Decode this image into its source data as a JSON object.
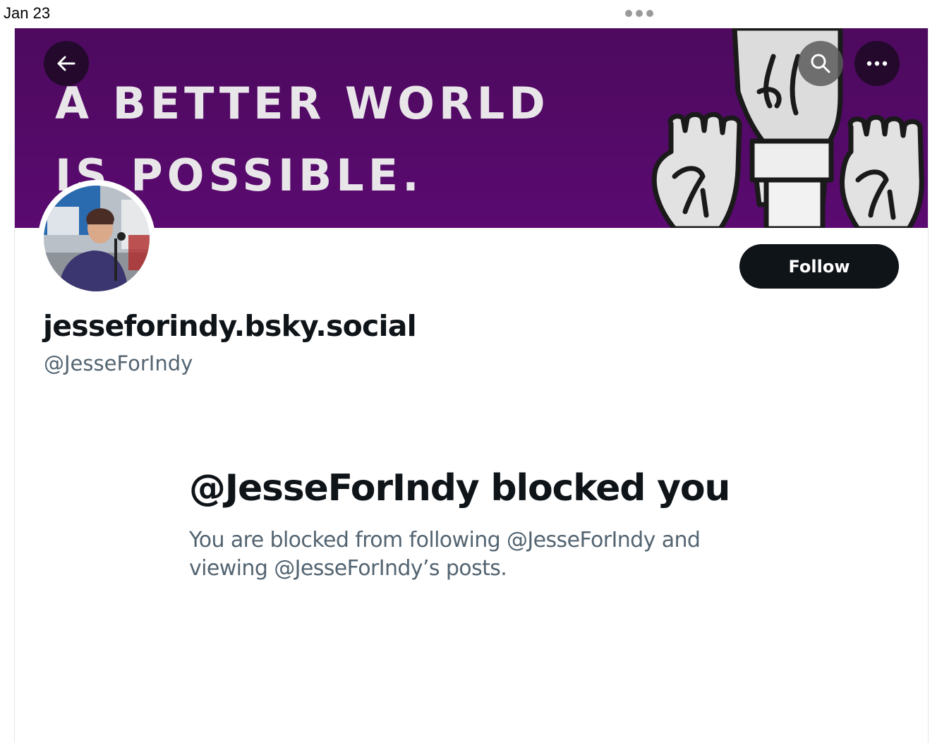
{
  "status_bar": {
    "date": "Jan 23"
  },
  "banner": {
    "line1": "A BETTER WORLD",
    "line2": "IS POSSIBLE.",
    "background_color": "#5a0a70"
  },
  "header_buttons": {
    "back_icon": "arrow-left-icon",
    "search_icon": "search-icon",
    "more_icon": "more-horizontal-icon"
  },
  "profile": {
    "display_name": "jesseforindy.bsky.social",
    "handle": "@JesseForIndy",
    "follow_label": "Follow"
  },
  "blocked": {
    "title": "@JesseForIndy blocked you",
    "description": "You are blocked from following @JesseForIndy and viewing @JesseForIndy’s posts."
  },
  "colors": {
    "primary_text": "#0f1419",
    "secondary_text": "#536471",
    "button_bg": "#0f1419"
  }
}
